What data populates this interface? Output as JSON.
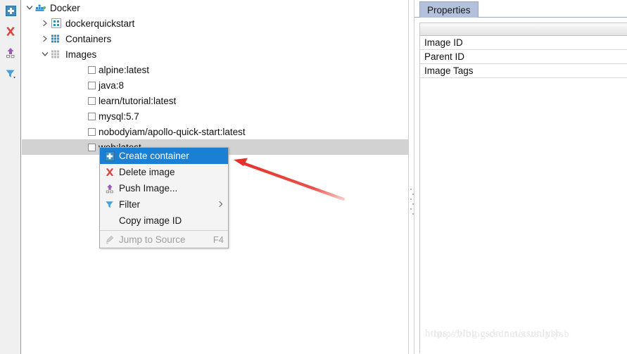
{
  "toolbar": {
    "buttons": [
      {
        "name": "add-icon",
        "title": "Create"
      },
      {
        "name": "delete-icon",
        "title": "Delete"
      },
      {
        "name": "push-icon",
        "title": "Push"
      },
      {
        "name": "filter-icon",
        "title": "Filter"
      }
    ]
  },
  "tree": {
    "root": {
      "label": "Docker",
      "expanded": true
    },
    "nodes": [
      {
        "label": "dockerquickstart",
        "expanded": false,
        "type": "folder"
      },
      {
        "label": "Containers",
        "expanded": false,
        "type": "folder"
      },
      {
        "label": "Images",
        "expanded": true,
        "type": "folder"
      }
    ],
    "images": [
      {
        "label": "alpine:latest",
        "checked": false,
        "selected": false
      },
      {
        "label": "java:8",
        "checked": false,
        "selected": false
      },
      {
        "label": "learn/tutorial:latest",
        "checked": false,
        "selected": false
      },
      {
        "label": "mysql:5.7",
        "checked": false,
        "selected": false
      },
      {
        "label": "nobodyiam/apollo-quick-start:latest",
        "checked": false,
        "selected": false
      },
      {
        "label": "web:latest",
        "checked": false,
        "selected": true
      }
    ]
  },
  "context_menu": {
    "items": [
      {
        "label": "Create container",
        "icon": "create-container-icon",
        "highlighted": true,
        "disabled": false,
        "accel": "",
        "submenu": false
      },
      {
        "label": "Delete image",
        "icon": "delete-image-icon",
        "highlighted": false,
        "disabled": false,
        "accel": "",
        "submenu": false
      },
      {
        "label": "Push Image...",
        "icon": "push-image-icon",
        "highlighted": false,
        "disabled": false,
        "accel": "",
        "submenu": false
      },
      {
        "label": "Filter",
        "icon": "filter-icon",
        "highlighted": false,
        "disabled": false,
        "accel": "",
        "submenu": true
      },
      {
        "label": "Copy image ID",
        "icon": "none",
        "highlighted": false,
        "disabled": false,
        "accel": "",
        "submenu": false
      },
      {
        "label": "Jump to Source",
        "icon": "jump-to-source-icon",
        "highlighted": false,
        "disabled": true,
        "accel": "F4",
        "submenu": false
      }
    ],
    "separator_before_index": 5
  },
  "properties": {
    "tab_label": "Properties",
    "rows": [
      {
        "name": "Image ID",
        "value": ""
      },
      {
        "name": "Parent ID",
        "value": ""
      },
      {
        "name": "Image Tags",
        "value": ""
      }
    ]
  },
  "watermark": {
    "text": "https://blog.csdn.net/zsunlysb",
    "text2": "https://blog.csdn.net/zsunlysb"
  },
  "colors": {
    "selection_gray": "#d2d2d2",
    "menu_highlight": "#1b7fd4",
    "tab_blue": "#b4c1dd",
    "toolbar_bg": "#f0f0f0",
    "annotation_red": "#e8302a",
    "docker_blue": "#1f8ad2"
  }
}
